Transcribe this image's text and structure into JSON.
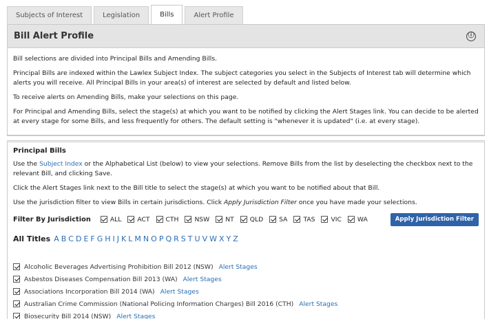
{
  "tabs": [
    {
      "label": "Subjects of Interest",
      "active": false
    },
    {
      "label": "Legislation",
      "active": false
    },
    {
      "label": "Bills",
      "active": true
    },
    {
      "label": "Alert Profile",
      "active": false
    }
  ],
  "header": {
    "title": "Bill Alert Profile",
    "info_icon": "ⓘ"
  },
  "intro": {
    "p1": "Bill selections are divided into Principal Bills and Amending Bills.",
    "p2": "Principal Bills are indexed within the Lawlex Subject Index. The subject categories you select in the Subjects of Interest tab will determine which alerts you will receive. All Principal Bills in your area(s) of interest are selected by default and listed below.",
    "p3": "To receive alerts on Amending Bills, make your selections on this page.",
    "p4": "For Principal and Amending Bills, select the stage(s) at which you want to be notified by clicking the Alert Stages link. You can decide to be alerted at every stage for some Bills, and less frequently for others. The default setting is \"whenever it is updated\" (i.e. at every stage)."
  },
  "principal": {
    "title": "Principal Bills",
    "p1_pre": "Use the ",
    "p1_link": "Subject Index",
    "p1_post": " or the Alphabetical List (below) to view your selections. Remove Bills from the list by deselecting the checkbox next to the relevant Bill, and clicking Save.",
    "p2": "Click the Alert Stages link next to the Bill title to select the stage(s) at which you want to be notified about that Bill.",
    "p3_pre": "Use the jurisdiction filter to view Bills in certain jurisdictions. Click ",
    "p3_em": "Apply Jurisdiction Filter",
    "p3_post": " once you have made your selections."
  },
  "filter": {
    "label": "Filter By Jurisdiction",
    "jurisdictions": [
      "ALL",
      "ACT",
      "CTH",
      "NSW",
      "NT",
      "QLD",
      "SA",
      "TAS",
      "VIC",
      "WA"
    ],
    "apply_label": "Apply Jurisdiction Filter"
  },
  "alpha": {
    "label": "All Titles",
    "letters": [
      "A",
      "B",
      "C",
      "D",
      "E",
      "F",
      "G",
      "H",
      "I",
      "J",
      "K",
      "L",
      "M",
      "N",
      "O",
      "P",
      "Q",
      "R",
      "S",
      "T",
      "U",
      "V",
      "W",
      "X",
      "Y",
      "Z"
    ]
  },
  "bills": [
    {
      "title": "Alcoholic Beverages Advertising Prohibition Bill 2012 (NSW)",
      "link": "Alert Stages"
    },
    {
      "title": "Asbestos Diseases Compensation Bill 2013 (WA)",
      "link": "Alert Stages"
    },
    {
      "title": "Associations Incorporation Bill 2014 (WA)",
      "link": "Alert Stages"
    },
    {
      "title": "Australian Crime Commission (National Policing Information Charges) Bill 2016 (CTH)",
      "link": "Alert Stages"
    },
    {
      "title": "Biosecurity Bill 2014 (NSW)",
      "link": "Alert Stages"
    }
  ]
}
